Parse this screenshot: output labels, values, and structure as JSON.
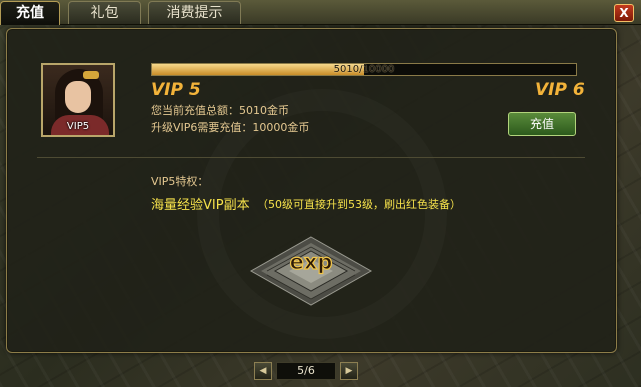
{
  "tabs": [
    {
      "label": "充值",
      "active": true
    },
    {
      "label": "礼包",
      "active": false
    },
    {
      "label": "消费提示",
      "active": false
    }
  ],
  "close_label": "X",
  "portrait": {
    "vip_tag": "VIP5"
  },
  "progress": {
    "text": "5010/10000",
    "current": 5010,
    "max": 10000
  },
  "vip": {
    "current": "VIP 5",
    "next": "VIP 6"
  },
  "info": {
    "total_recharge": "您当前充值总额：5010金币",
    "upgrade_need": "升级VIP6需要充值：10000金币"
  },
  "recharge_button": "充值",
  "privileges": {
    "title": "VIP5特权：",
    "main": "海量经验VIP副本",
    "note": "（50级可直接升到53级，刷出红色装备）"
  },
  "exp_label": "exp",
  "pager": {
    "label": "5/6",
    "prev_icon": "left-triangle",
    "next_icon": "right-triangle"
  },
  "colors": {
    "gold": "#f3b33a",
    "highlight": "#f6e24b",
    "text": "#e4c891",
    "button_green": "#3f7a2a"
  }
}
